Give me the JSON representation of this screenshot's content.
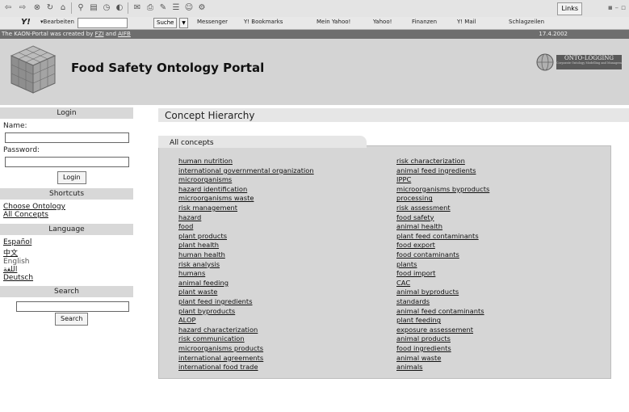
{
  "browser": {
    "links_label": "Links",
    "yahoo": {
      "edit_label": "▾Bearbeiten",
      "search_label": "Suche",
      "links": [
        "Messenger",
        "Y! Bookmarks",
        "Mein Yahoo!",
        "Yahoo!",
        "Finanzen",
        "Y! Mail",
        "Schlagzeilen"
      ]
    }
  },
  "credits": {
    "text_before": "The KAON-Portal was created by",
    "fzi": "FZI",
    "and": "and",
    "aifb": "AIFB",
    "date": "17.4.2002"
  },
  "header": {
    "title": "Food Safety Ontology Portal",
    "logo_text": "ONTO-LOGGING",
    "logo_sub": "Corporate Ontology Modelling and Management System"
  },
  "login": {
    "heading": "Login",
    "name_label": "Name:",
    "name_value": "",
    "password_label": "Password:",
    "password_value": "",
    "button": "Login"
  },
  "shortcuts": {
    "heading": "Shortcuts",
    "items": [
      "Choose Ontology",
      "All Concepts"
    ]
  },
  "language": {
    "heading": "Language",
    "items": [
      "Español",
      "中文",
      "English",
      "اللغة",
      "Deutsch"
    ]
  },
  "search": {
    "heading": "Search",
    "value": "",
    "button": "Search"
  },
  "main": {
    "title": "Concept Hierarchy",
    "tab": "All concepts",
    "concepts_left": [
      "human nutrition",
      "international governmental organization",
      "microorganisms",
      "hazard identification",
      "microorganisms waste",
      "risk management",
      "hazard",
      "food",
      "plant products",
      "plant health",
      "human health",
      "risk analysis",
      "humans",
      "animal feeding",
      "plant waste",
      "plant feed ingredients",
      "plant byproducts",
      "ALOP",
      "hazard characterization",
      "risk communication",
      "microorganisms products",
      "international agreements",
      "international food trade"
    ],
    "concepts_right": [
      "risk characterization",
      "animal feed ingredients",
      "IPPC",
      "microorganisms byproducts",
      "processing",
      "risk assessment",
      "food safety",
      "animal health",
      "plant feed contaminants",
      "food export",
      "food contaminants",
      "plants",
      "food import",
      "CAC",
      "animal byproducts",
      "standards",
      "animal feed contaminants",
      "plant feeding",
      "exposure assessement",
      "animal products",
      "food ingredients",
      "animal waste",
      "animals"
    ]
  }
}
